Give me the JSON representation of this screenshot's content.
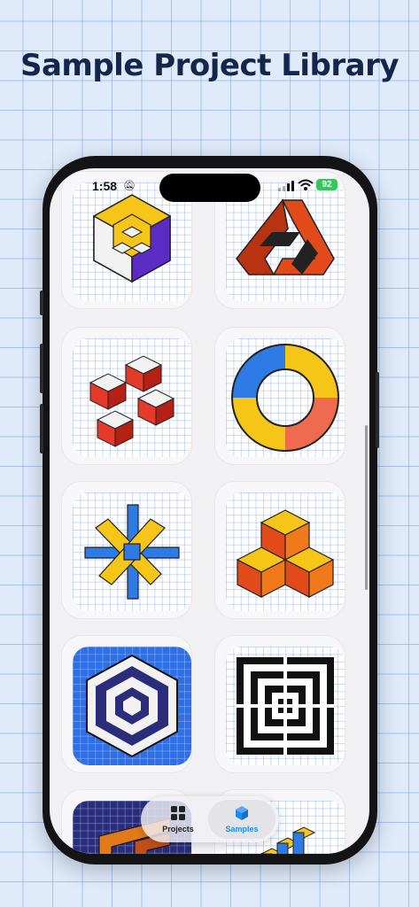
{
  "headline": "Sample Project Library",
  "status_bar": {
    "time": "1:58",
    "battery": "92"
  },
  "tabs": [
    {
      "label": "Projects",
      "icon": "grid-icon",
      "selected": false
    },
    {
      "label": "Samples",
      "icon": "cube-icon",
      "selected": true
    }
  ],
  "colors": {
    "accent": "#1d8cf2",
    "background": "#dfeafb",
    "headline": "#16264a"
  }
}
